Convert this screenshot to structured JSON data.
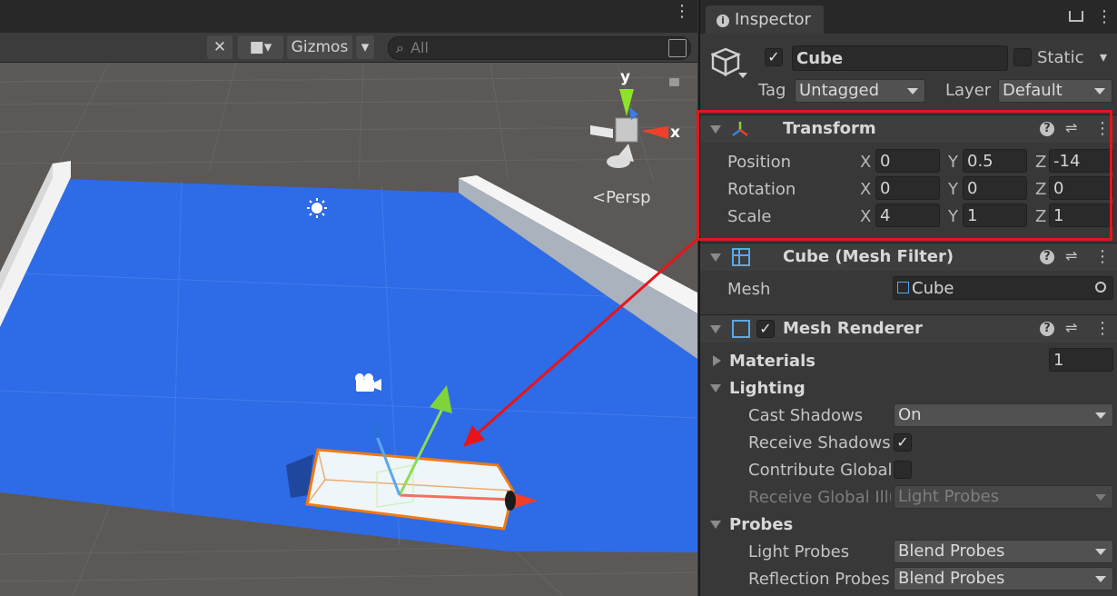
{
  "scene": {
    "toolbar": {
      "gizmos_label": "Gizmos",
      "search_placeholder": "All"
    },
    "orientation_gizmo": {
      "y_label": "y",
      "x_label": "x",
      "projection_label": "Persp"
    }
  },
  "inspector": {
    "tab_label": "Inspector",
    "object": {
      "name": "Cube",
      "active": true,
      "static_label": "Static",
      "tag_label": "Tag",
      "tag_value": "Untagged",
      "layer_label": "Layer",
      "layer_value": "Default"
    },
    "transform": {
      "title": "Transform",
      "position_label": "Position",
      "rotation_label": "Rotation",
      "scale_label": "Scale",
      "axis_x": "X",
      "axis_y": "Y",
      "axis_z": "Z",
      "position": {
        "x": "0",
        "y": "0.5",
        "z": "-14"
      },
      "rotation": {
        "x": "0",
        "y": "0",
        "z": "0"
      },
      "scale": {
        "x": "4",
        "y": "1",
        "z": "1"
      }
    },
    "mesh_filter": {
      "title": "Cube (Mesh Filter)",
      "mesh_label": "Mesh",
      "mesh_value": "Cube"
    },
    "mesh_renderer": {
      "title": "Mesh Renderer",
      "enabled": true,
      "materials_label": "Materials",
      "materials_count": "1",
      "lighting_label": "Lighting",
      "cast_shadows_label": "Cast Shadows",
      "cast_shadows_value": "On",
      "receive_shadows_label": "Receive Shadows",
      "contribute_global_label": "Contribute Global",
      "receive_gi_label": "Receive Global Illu",
      "receive_gi_value": "Light Probes",
      "probes_label": "Probes",
      "light_probes_label": "Light Probes",
      "light_probes_value": "Blend Probes",
      "reflection_probes_label": "Reflection Probes",
      "reflection_probes_value": "Blend Probes"
    }
  },
  "colors": {
    "highlight_red": "#e8141a",
    "plane_blue": "#2e6be6",
    "selection_orange": "#f07a14"
  }
}
